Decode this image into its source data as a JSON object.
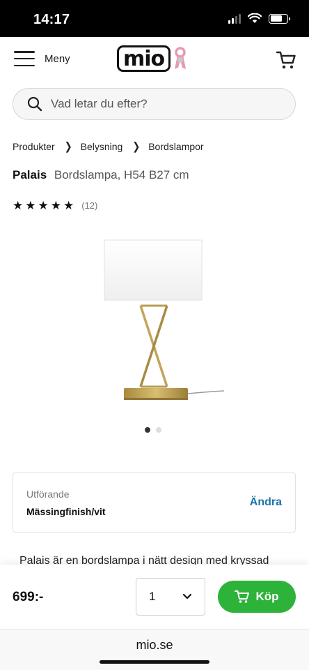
{
  "status_bar": {
    "time": "14:17"
  },
  "header": {
    "menu_label": "Meny",
    "logo_text": "mio"
  },
  "search": {
    "placeholder": "Vad letar du efter?"
  },
  "breadcrumb": {
    "items": [
      "Produkter",
      "Belysning",
      "Bordslampor"
    ]
  },
  "product": {
    "name": "Palais",
    "description_short": "Bordslampa, H54 B27 cm",
    "rating_count": "(12)",
    "stars": 5,
    "image_count": 2,
    "active_image": 0
  },
  "variant": {
    "label": "Utförande",
    "value": "Mässingfinish/vit",
    "change_label": "Ändra"
  },
  "description": {
    "text": "Palais är en bordslampa i nätt design med kryssad"
  },
  "buy_bar": {
    "price": "699:-",
    "quantity": "1",
    "buy_label": "Köp"
  },
  "browser": {
    "url": "mio.se"
  },
  "colors": {
    "buy_green": "#2eb33a",
    "link_blue": "#1a73a8",
    "brand_pink": "#e59ab4"
  }
}
